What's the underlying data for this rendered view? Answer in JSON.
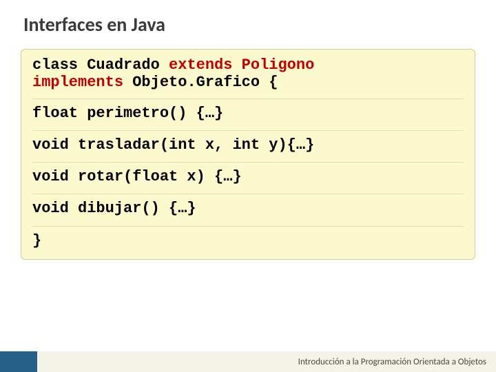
{
  "title": "Interfaces en Java",
  "code": {
    "l1a": "class Cuadrado ",
    "l1b": "extends Poligono",
    "l2a": "implements",
    "l2b": " Objeto.Grafico {",
    "l3": "float perimetro() {…}",
    "l4": "void trasladar(int x, int y){…}",
    "l5": "void rotar(float x) {…}",
    "l6": "void dibujar() {…}",
    "l7": "}"
  },
  "footer": "Introducción a la Programación Orientada a Objetos"
}
